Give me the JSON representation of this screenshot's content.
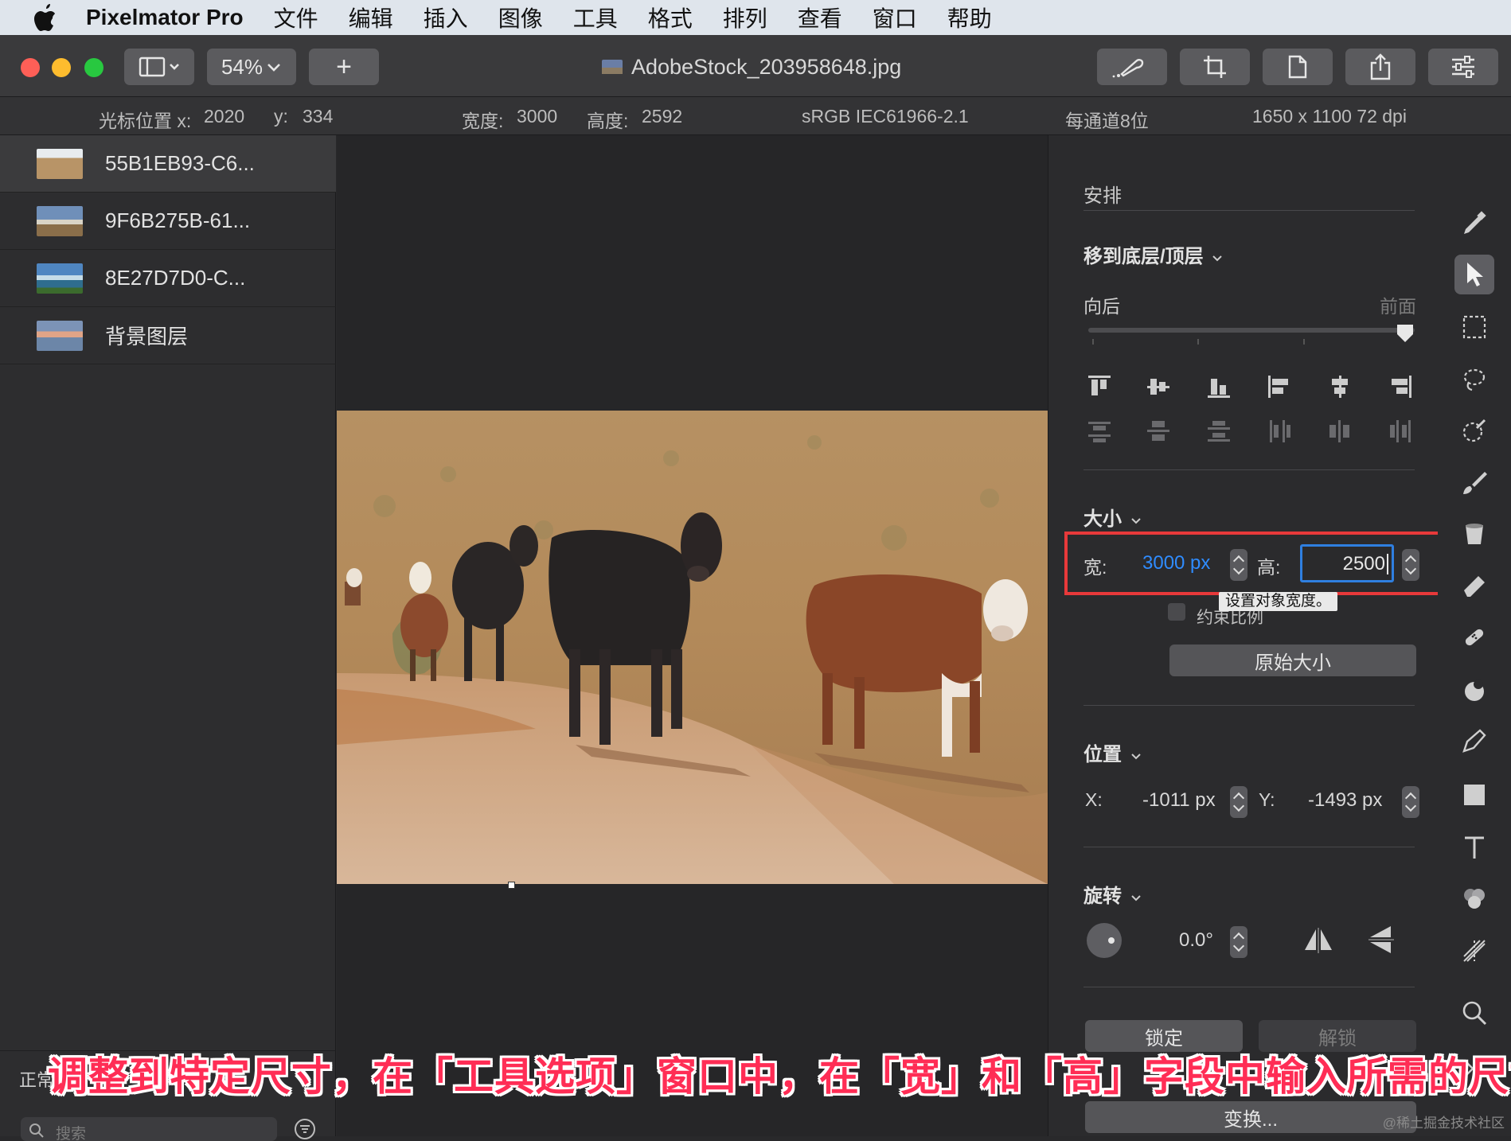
{
  "menubar": {
    "app_name": "Pixelmator Pro",
    "items": [
      "文件",
      "编辑",
      "插入",
      "图像",
      "工具",
      "格式",
      "排列",
      "查看",
      "窗口",
      "帮助"
    ]
  },
  "toolbar": {
    "zoom": "54%",
    "add_label": "+",
    "document_title": "AdobeStock_203958648.jpg"
  },
  "infobar": {
    "cursor_x_label": "光标位置 x:",
    "cursor_x": "2020",
    "cursor_y_label": "y:",
    "cursor_y": "334",
    "width_label": "宽度:",
    "width": "3000",
    "height_label": "高度:",
    "height": "2592",
    "color_profile": "sRGB IEC61966-2.1",
    "bit_depth": "每通道8位",
    "resolution": "1650 x 1100 72 dpi"
  },
  "layers": [
    {
      "name": "55B1EB93-C6...",
      "selected": true
    },
    {
      "name": "9F6B275B-61...",
      "selected": false
    },
    {
      "name": "8E27D7D0-C...",
      "selected": false
    },
    {
      "name": "背景图层",
      "selected": false
    }
  ],
  "layers_footer": {
    "blend_mode": "正常",
    "search_placeholder": "搜索"
  },
  "arrange_panel": {
    "section_title": "安排",
    "order_dropdown": "移到底层/顶层",
    "back_label": "向后",
    "front_label": "前面",
    "order_slider_fraction": 1.0,
    "size_header": "大小",
    "width_label": "宽:",
    "width_value": "3000 px",
    "height_label": "高:",
    "height_value": "2500",
    "tooltip": "设置对象宽度。",
    "constrain_label": "约束比例",
    "original_size_button": "原始大小",
    "position_header": "位置",
    "x_label": "X:",
    "x_value": "-1011 px",
    "y_label": "Y:",
    "y_value": "-1493 px",
    "rotation_header": "旋转",
    "rotation_value": "0.0°",
    "lock_button": "锁定",
    "unlock_button": "解锁",
    "transform_button": "变换..."
  },
  "caption": "调整到特定尺寸，在「工具选项」窗口中，在「宽」和「高」字段中输入所需的尺寸",
  "watermark": "@稀土掘金技术社区",
  "colors": {
    "highlight_box": "#e8393a",
    "accent_blue": "#2f8cff",
    "caption_red": "#ff2d55"
  },
  "icons": [
    "apple-icon",
    "sidebar-toggle-icon",
    "brush-style-icon",
    "crop-icon",
    "document-icon",
    "share-icon",
    "adjust-sliders-icon",
    "paint-style-icon",
    "arrow-select-icon",
    "rect-select-icon",
    "lasso-icon",
    "quick-select-icon",
    "paint-brush-icon",
    "fill-bucket-icon",
    "eraser-icon",
    "repair-icon",
    "retouch-icon",
    "pen-icon",
    "shape-icon",
    "type-icon",
    "color-adjust-icon",
    "distort-icon",
    "zoom-icon"
  ]
}
